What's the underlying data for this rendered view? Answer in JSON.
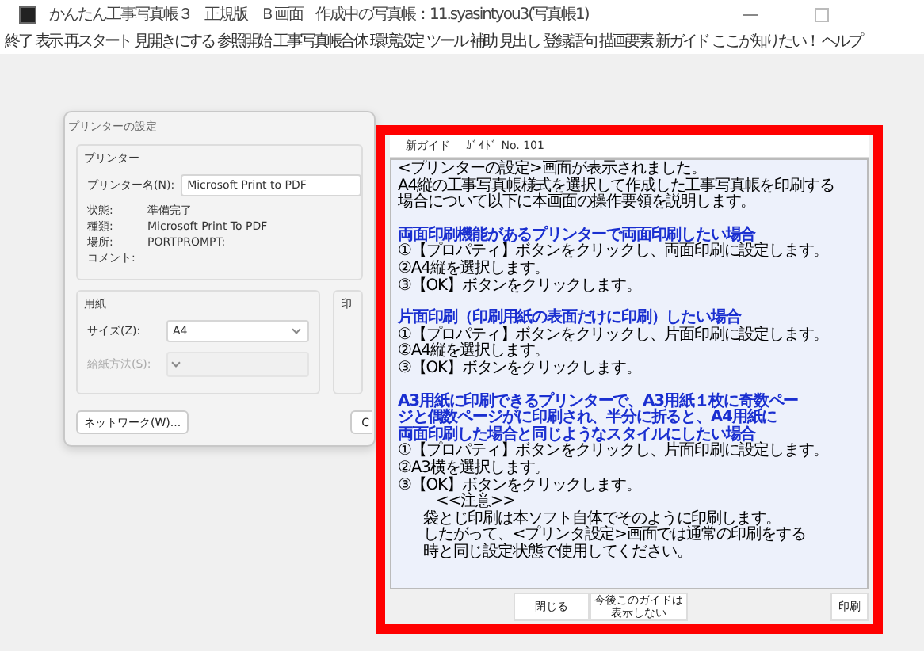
{
  "title_bar": {
    "parts": [
      "かんたん工事写真帳３",
      "正規版",
      "Ｂ画面",
      "作成中の写真帳：11.syasintyou3(写真帳1)"
    ]
  },
  "menu": {
    "items": [
      "終了",
      "表示",
      "再スタート",
      "見開きにする",
      "参照開始",
      "工事写真帳合体",
      "環境設定",
      "ツール",
      "補助",
      "見出し",
      "登録語句",
      "描画要素",
      "新ガイド",
      "ここが知りたい！",
      "ヘルプ"
    ]
  },
  "printer_dialog": {
    "title": "プリンターの設定",
    "printer_group": {
      "label": "プリンター",
      "name_label": "プリンター名(N):",
      "name_value": "Microsoft Print to PDF",
      "info": [
        {
          "label": "状態:",
          "value": "準備完了"
        },
        {
          "label": "種類:",
          "value": "Microsoft Print To PDF"
        },
        {
          "label": "場所:",
          "value": "PORTPROMPT:"
        },
        {
          "label": "コメント:"
        }
      ]
    },
    "paper_group": {
      "label": "用紙",
      "fields": [
        {
          "label": "サイズ(Z):",
          "value": "A4",
          "disabled": false
        },
        {
          "label": "給紙方法(S):",
          "disabled": true
        }
      ]
    },
    "orientation_group": {
      "label": "印"
    },
    "network_button": "ネットワーク(W)...",
    "ok_button": "C"
  },
  "guide": {
    "header": [
      "新ガイド",
      "ｶﾞｲﾄﾞ No. 101"
    ],
    "blocks": [
      {
        "kind": "text",
        "lines": [
          "<プリンターの設定>画面が表示されました。",
          "A4縦の工事写真帳様式を選択して作成した工事写真帳を印刷する",
          "場合について以下に本画面の操作要領を説明します。"
        ]
      },
      {
        "kind": "heading",
        "lines": [
          "両面印刷機能があるプリンターで両面印刷したい場合"
        ]
      },
      {
        "kind": "text",
        "lines": [
          "①【プロパティ】ボタンをクリックし、両面印刷に設定します。",
          "②A4縦を選択します。",
          "③【OK】ボタンをクリックします。"
        ]
      },
      {
        "kind": "heading",
        "lines": [
          "片面印刷（印刷用紙の表面だけに印刷）したい場合"
        ]
      },
      {
        "kind": "text",
        "lines": [
          "①【プロパティ】ボタンをクリックし、片面印刷に設定します。",
          "②A4縦を選択します。",
          "③【OK】ボタンをクリックします。"
        ]
      },
      {
        "kind": "heading",
        "lines": [
          "A3用紙に印刷できるプリンターで、A3用紙１枚に奇数ペー",
          "ジと偶数ページがに印刷され、半分に折ると、A4用紙に",
          "両面印刷した場合と同じようなスタイルにしたい場合"
        ]
      },
      {
        "kind": "text",
        "lines": [
          "①【プロパティ】ボタンをクリックし、片面印刷に設定します。",
          "②A3横を選択します。",
          "③【OK】ボタンをクリックします。"
        ]
      },
      {
        "kind": "note",
        "lines": [
          "<<注意>>",
          "袋とじ印刷は本ソフト自体でそのように印刷します。",
          "したがって、<プリンタ設定>画面では通常の印刷をする",
          "時と同じ設定状態で使用してください。"
        ]
      }
    ],
    "buttons": [
      {
        "kind": "close",
        "label": "閉じる"
      },
      {
        "kind": "hide",
        "label": "今後このガイドは表示しない"
      },
      {
        "kind": "print",
        "label": "印刷"
      }
    ]
  }
}
